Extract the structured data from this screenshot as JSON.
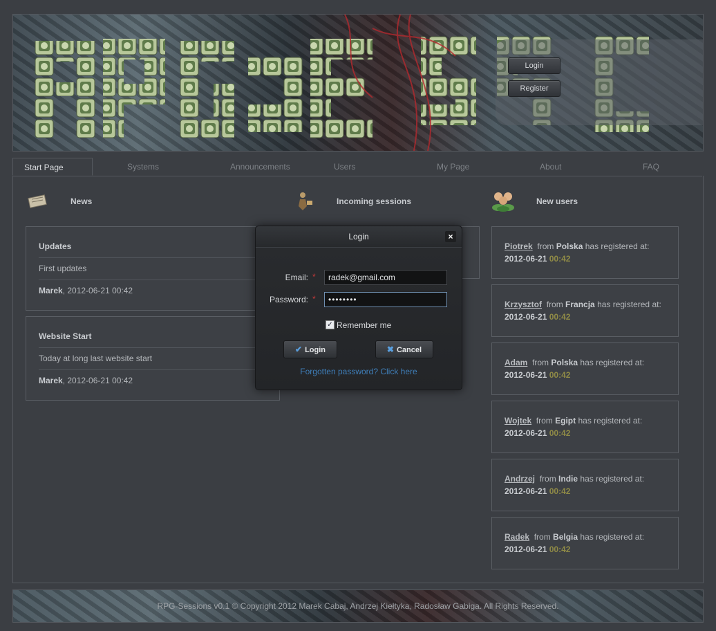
{
  "header": {
    "auth": {
      "login_label": "Login",
      "register_label": "Register"
    }
  },
  "nav": {
    "tabs": [
      {
        "label": "Start Page",
        "active": true
      },
      {
        "label": "Systems"
      },
      {
        "label": "Announcements"
      },
      {
        "label": "Users"
      },
      {
        "label": "My Page"
      },
      {
        "label": "About"
      },
      {
        "label": "FAQ"
      }
    ]
  },
  "news": {
    "title": "News",
    "items": [
      {
        "title": "Updates",
        "text": "First updates",
        "author": "Marek",
        "date": ", 2012-06-21 00:42"
      },
      {
        "title": "Website Start",
        "text": "Today at long last website start",
        "author": "Marek",
        "date": ", 2012-06-21 00:42"
      }
    ]
  },
  "sessions": {
    "title": "Incoming sessions"
  },
  "new_users": {
    "title": "New users",
    "from_word": "from",
    "registered_text": "has registered at:",
    "items": [
      {
        "name": "Piotrek",
        "country": "Polska",
        "date": "2012-06-21",
        "time": "00:42"
      },
      {
        "name": "Krzysztof",
        "country": "Francja",
        "date": "2012-06-21",
        "time": "00:42"
      },
      {
        "name": "Adam",
        "country": "Polska",
        "date": "2012-06-21",
        "time": "00:42"
      },
      {
        "name": "Wojtek",
        "country": "Egipt",
        "date": "2012-06-21",
        "time": "00:42"
      },
      {
        "name": "Andrzej",
        "country": "Indie",
        "date": "2012-06-21",
        "time": "00:42"
      },
      {
        "name": "Radek",
        "country": "Belgia",
        "date": "2012-06-21",
        "time": "00:42"
      }
    ]
  },
  "login_dialog": {
    "title": "Login",
    "close_label": "×",
    "email_label": "Email:",
    "email_value": "radek@gmail.com",
    "password_label": "Password:",
    "password_value": "••••••••",
    "required_mark": "*",
    "remember_label": "Remember me",
    "remember_checked": true,
    "login_button": "Login",
    "cancel_button": "Cancel",
    "forgot_text": "Forgotten password? Click here"
  },
  "footer": {
    "text": "RPG-Sessions v0.1 © Copyright 2012  Marek Cabaj, Andrzej Kiełtyka, Radosław Gabiga. All Rights Reserved."
  },
  "colors": {
    "background": "#3b3e43",
    "link_blue": "#3f7fb9",
    "time_olive": "#8f8a46",
    "required_red": "#c8393a"
  }
}
